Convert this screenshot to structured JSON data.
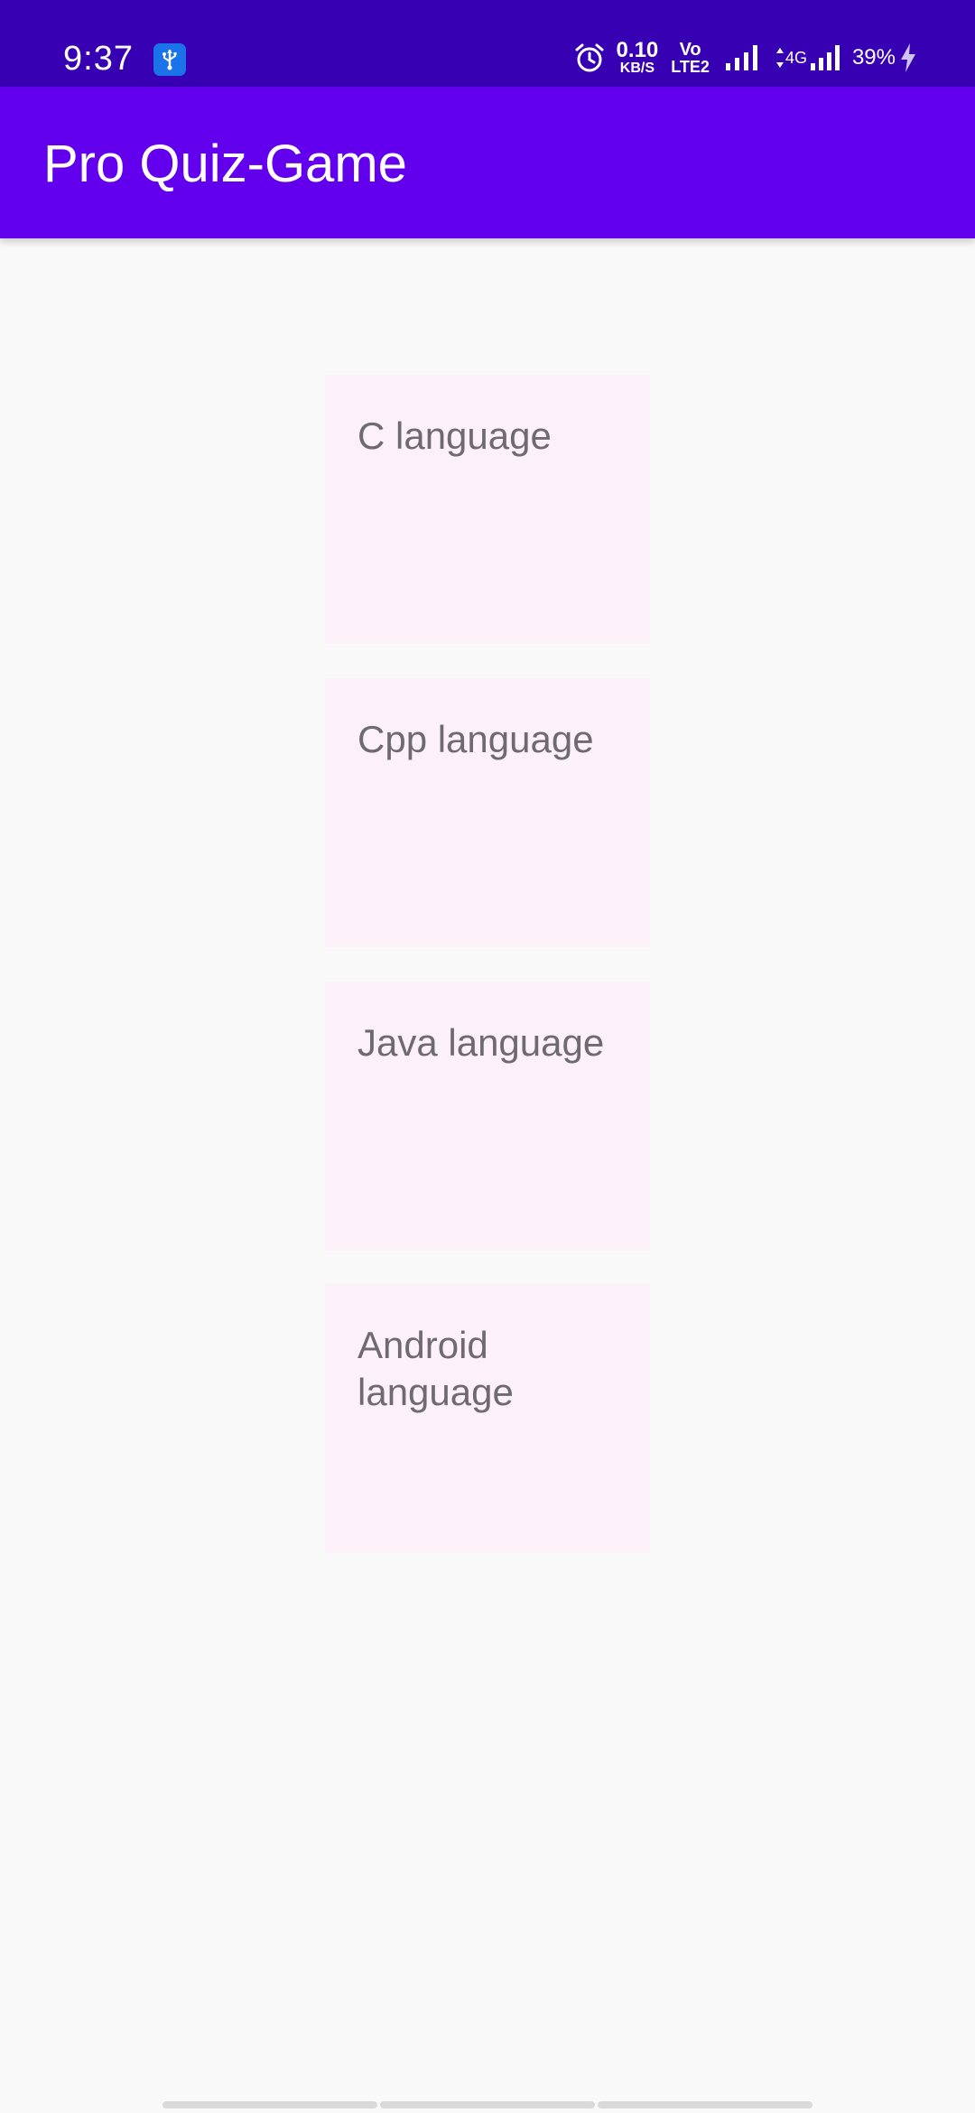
{
  "status_bar": {
    "time": "9:37",
    "usb_icon": "usb-icon",
    "alarm_icon": "alarm-icon",
    "net_speed_value": "0.10",
    "net_speed_unit": "KB/S",
    "volte_top": "Vo",
    "volte_bottom": "LTE2",
    "network_type": "4G",
    "battery_percent": "39%",
    "charging_icon": "bolt-icon",
    "colors": {
      "background": "#3700b3",
      "usb_badge": "#1a73e8"
    }
  },
  "app_bar": {
    "title": "Pro Quiz-Game",
    "color": "#6200ee"
  },
  "categories": [
    {
      "label": "C language"
    },
    {
      "label": "Cpp language"
    },
    {
      "label": "Java language"
    },
    {
      "label": "Android language"
    }
  ],
  "theme": {
    "page_background": "#f9f9f9",
    "card_background": "#fcf0f9",
    "card_text": "#6f6a70"
  }
}
